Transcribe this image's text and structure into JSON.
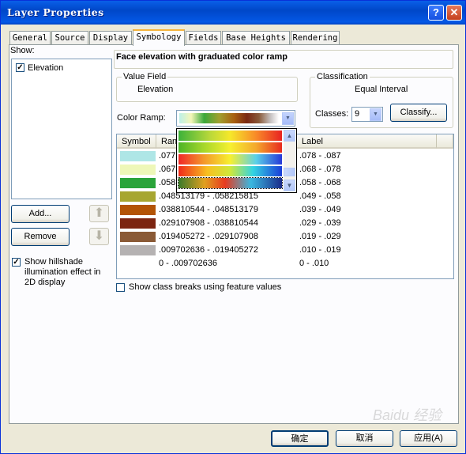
{
  "window": {
    "title": "Layer Properties",
    "help_glyph": "?",
    "close_glyph": "✕"
  },
  "tabs": [
    {
      "label": "General"
    },
    {
      "label": "Source"
    },
    {
      "label": "Display"
    },
    {
      "label": "Symbology",
      "active": true
    },
    {
      "label": "Fields"
    },
    {
      "label": "Base Heights"
    },
    {
      "label": "Rendering"
    }
  ],
  "show": {
    "label": "Show:",
    "items": [
      {
        "label": "Elevation",
        "checked": true
      }
    ]
  },
  "side_buttons": {
    "add": "Add...",
    "remove": "Remove",
    "up_glyph": "⬆",
    "down_glyph": "⬇"
  },
  "hillshade": {
    "label_lines": [
      "Show hillshade",
      "illumination effect in",
      "2D display"
    ],
    "checked": true
  },
  "heading": "Face elevation with graduated color ramp",
  "value_field": {
    "title": "Value Field",
    "value": "Elevation"
  },
  "classification": {
    "title": "Classification",
    "method": "Equal Interval",
    "classes_label": "Classes:",
    "classes_value": "9",
    "classify_button": "Classify..."
  },
  "color_ramp_label": "Color Ramp:",
  "table": {
    "headers": [
      "Symbol",
      "Range",
      "Label"
    ],
    "rows": [
      {
        "color": "#AEE6E6",
        "range": ".077",
        "label": ".078 - .087"
      },
      {
        "color": "#EEF7B8",
        "range": ".067",
        "label": ".068 - .078"
      },
      {
        "color": "#2AA43A",
        "range": ".058",
        "label": ".058 - .068"
      },
      {
        "color": "#A7A630",
        "range": ".048513179 - .058215815",
        "label": ".049 - .058"
      },
      {
        "color": "#B35406",
        "range": ".038810544 - .048513179",
        "label": ".039 - .049"
      },
      {
        "color": "#7C2410",
        "range": ".029107908 - .038810544",
        "label": ".029 - .039"
      },
      {
        "color": "#8A5A36",
        "range": ".019405272 - .029107908",
        "label": ".019 - .029"
      },
      {
        "color": "#B5B2B2",
        "range": ".009702636 - .019405272",
        "label": ".010 - .019"
      },
      {
        "color": "#FFFFFF",
        "range": "0 - .009702636",
        "label": "0 - .010"
      }
    ]
  },
  "show_breaks_label": "Show class breaks using feature values",
  "footer": {
    "ok": "确定",
    "cancel": "取消",
    "apply": "应用(A)"
  },
  "watermark": "Baidu 经验"
}
